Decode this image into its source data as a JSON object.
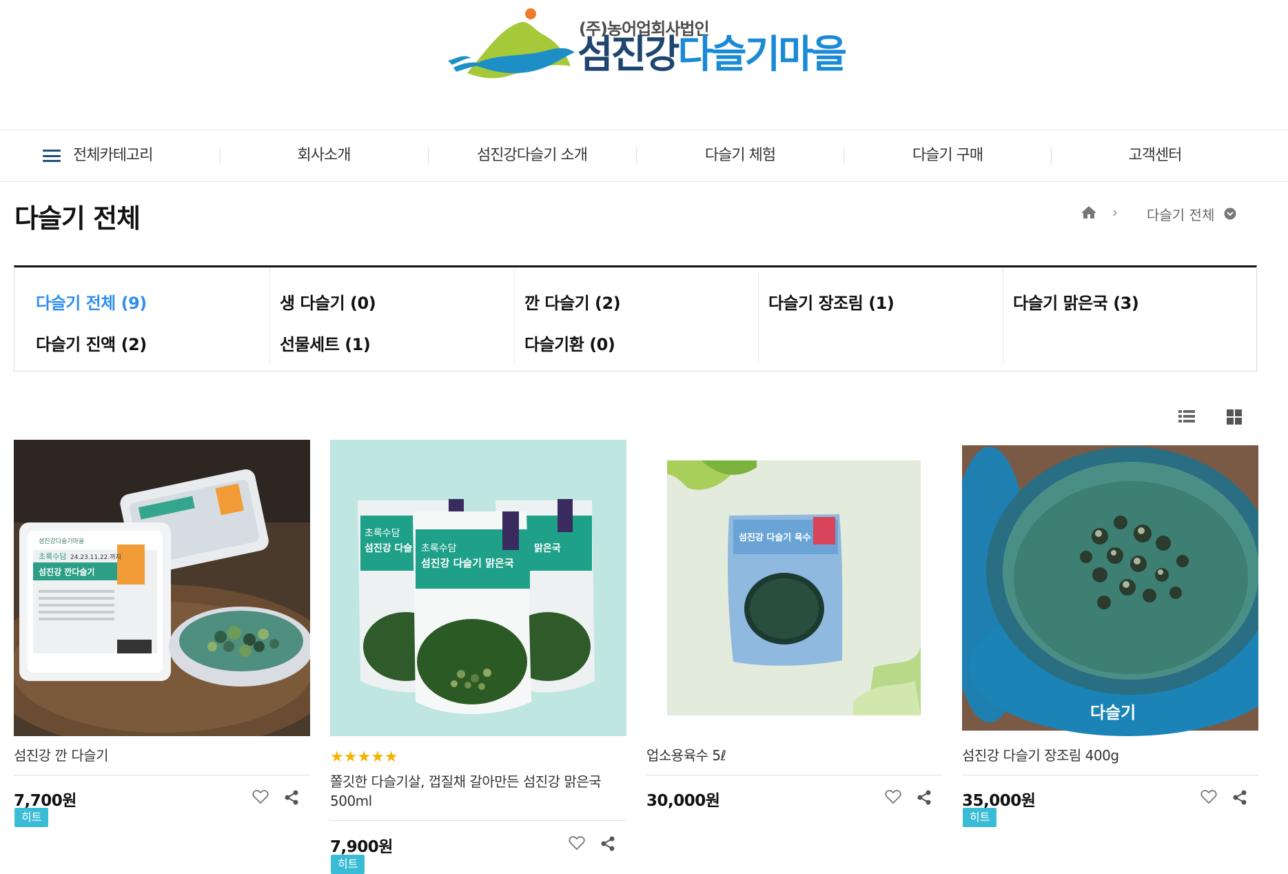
{
  "logo": {
    "subtitle": "(주)농어업회사법인",
    "title_part1": "섬진강",
    "title_part2": "다슬기마을",
    "colors": {
      "green": "#a6c93a",
      "blue": "#1e8fc6",
      "navy": "#20456f",
      "orange": "#f07a2a"
    }
  },
  "nav": {
    "all_category": "전체카테고리",
    "items": [
      {
        "label": "회사소개"
      },
      {
        "label": "섬진강다슬기 소개"
      },
      {
        "label": "다슬기 체험"
      },
      {
        "label": "다슬기 구매"
      },
      {
        "label": "고객센터"
      }
    ]
  },
  "page": {
    "title": "다슬기 전체",
    "breadcrumb_current": "다슬기 전체"
  },
  "categories": [
    {
      "label": "다슬기 전체",
      "count": "(9)",
      "active": true
    },
    {
      "label": "생 다슬기",
      "count": "(0)"
    },
    {
      "label": "깐 다슬기",
      "count": "(2)"
    },
    {
      "label": "다슬기 장조림",
      "count": "(1)"
    },
    {
      "label": "다슬기 맑은국",
      "count": "(3)"
    },
    {
      "label": "다슬기 진액",
      "count": "(2)"
    },
    {
      "label": "선물세트",
      "count": "(1)"
    },
    {
      "label": "다슬기환",
      "count": "(0)"
    }
  ],
  "products": [
    {
      "name": "섬진강 깐 다슬기",
      "price": "7,700원",
      "badge": "히트",
      "pack_brand": "섬진강다슬기마을",
      "pack_title": "섬진강 깐다슬기",
      "pack_brand2": "초록수담",
      "pack_date": "24.23.11.22.까지"
    },
    {
      "name": "쫄깃한 다슬기살, 껍질채 갈아만든 섬진강 맑은국 500ml",
      "price": "7,900원",
      "badge": "히트",
      "rating": "★★★★★",
      "pack_brand": "초록수담",
      "pack_title": "섬진강 다슬기 맑은국",
      "pack_title_short": "섬진강 다슬",
      "pack_title_side": "맑은국"
    },
    {
      "name": "업소용육수 5ℓ",
      "price": "30,000원",
      "pack_title": "섬진강 다슬기 육수"
    },
    {
      "name": "섬진강 다슬기 장조림 400g",
      "price": "35,000원",
      "badge": "히트",
      "jar_text": "다슬기"
    }
  ]
}
